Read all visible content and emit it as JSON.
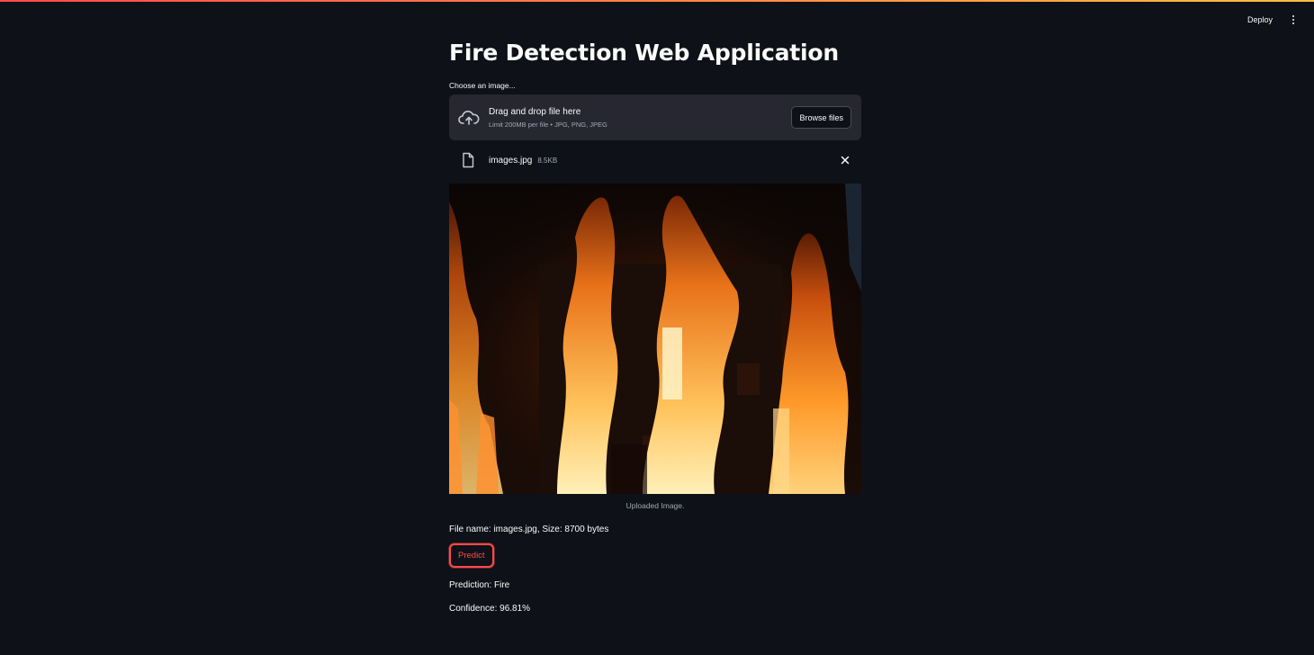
{
  "header": {
    "deploy_label": "Deploy",
    "menu_icon": "vertical-dots-icon"
  },
  "main": {
    "title": "Fire Detection Web Application",
    "uploader": {
      "label": "Choose an image...",
      "drop_title": "Drag and drop file here",
      "drop_limit": "Limit 200MB per file • JPG, PNG, JPEG",
      "browse_label": "Browse files",
      "upload_icon": "cloud-upload-icon"
    },
    "uploaded_file": {
      "name": "images.jpg",
      "size": "8.5KB",
      "file_icon": "file-icon",
      "close_icon": "close-icon"
    },
    "image": {
      "caption": "Uploaded Image."
    },
    "file_info": "File name: images.jpg, Size: 8700 bytes",
    "predict_label": "Predict",
    "prediction": "Prediction: Fire",
    "confidence": "Confidence: 96.81%"
  },
  "colors": {
    "background": "#0e1117",
    "surface": "#262730",
    "accent": "#ff4b4b",
    "text": "#fafafa",
    "muted": "#a3a8b8"
  }
}
